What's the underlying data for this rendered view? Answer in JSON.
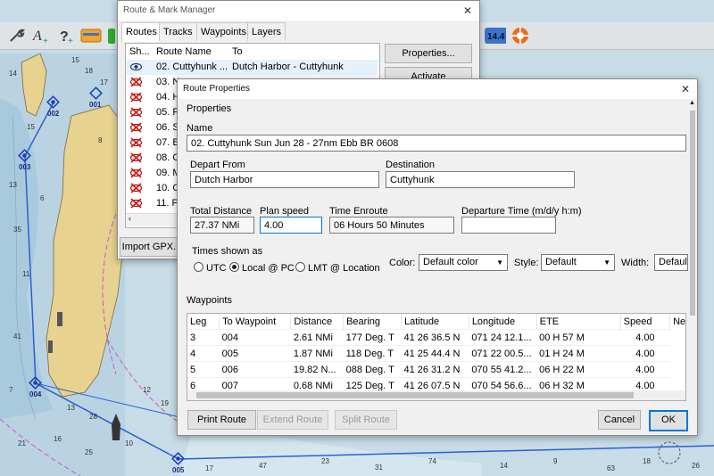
{
  "toolbar": {
    "icons": [
      "wrench-icon",
      "add-route-icon",
      "help-icon",
      "layers-icon",
      "battery-icon",
      "zoom-14-icon",
      "lifebuoy-icon"
    ],
    "zoom_label": "14.4"
  },
  "map": {
    "waypoint_labels": [
      "002",
      "003",
      "004",
      "005",
      "001"
    ],
    "depth_numbers": [
      "15",
      "18",
      "14",
      "17",
      "15",
      "13",
      "35",
      "11",
      "8",
      "6",
      "41",
      "7",
      "13",
      "28",
      "12",
      "19",
      "21",
      "16",
      "25",
      "10",
      "17",
      "47",
      "23",
      "31",
      "74",
      "14",
      "9",
      "63",
      "18",
      "26"
    ]
  },
  "route_manager": {
    "title": "Route & Mark Manager",
    "tabs": [
      "Routes",
      "Tracks",
      "Waypoints",
      "Layers"
    ],
    "columns": [
      "Sh...",
      "Route Name",
      "To"
    ],
    "rows": [
      {
        "name": "02. Cuttyhunk ...",
        "to": "Dutch Harbor - Cuttyhunk",
        "shown": true
      },
      {
        "name": "03. N",
        "to": "",
        "shown": false
      },
      {
        "name": "04. H",
        "to": "",
        "shown": false
      },
      {
        "name": "05. R",
        "to": "",
        "shown": false
      },
      {
        "name": "06. S",
        "to": "",
        "shown": false
      },
      {
        "name": "07. B",
        "to": "",
        "shown": false
      },
      {
        "name": "08. C",
        "to": "",
        "shown": false
      },
      {
        "name": "09. M",
        "to": "",
        "shown": false
      },
      {
        "name": "10. G",
        "to": "",
        "shown": false
      },
      {
        "name": "11. P",
        "to": "",
        "shown": false
      }
    ],
    "properties_button": "Properties...",
    "activate_button": "Activate",
    "import_button": "Import GPX..."
  },
  "route_props": {
    "title": "Route Properties",
    "properties_section": "Properties",
    "name_label": "Name",
    "name_value": "02. Cuttyhunk Sun Jun 28 -  27nm Ebb BR 0608",
    "depart_label": "Depart From",
    "depart_value": "Dutch Harbor",
    "destination_label": "Destination",
    "destination_value": "Cuttyhunk",
    "total_distance_label": "Total Distance",
    "total_distance_value": "27.37 NMi",
    "plan_speed_label": "Plan speed",
    "plan_speed_value": "4.00",
    "time_enroute_label": "Time Enroute",
    "time_enroute_value": "06 Hours  50 Minutes",
    "departure_time_label": "Departure Time (m/d/y h:m)",
    "departure_time_value": "",
    "times_shown_label": "Times shown as",
    "time_options": [
      "UTC",
      "Local @ PC",
      "LMT @ Location"
    ],
    "time_selected": "Local @ PC",
    "color_label": "Color:",
    "color_value": "Default color",
    "style_label": "Style:",
    "style_value": "Default",
    "width_label": "Width:",
    "width_value": "Default",
    "waypoints_section": "Waypoints",
    "wp_columns": [
      "Leg",
      "To Waypoint",
      "Distance",
      "Bearing",
      "Latitude",
      "Longitude",
      "ETE",
      "Speed",
      "Ne"
    ],
    "wp_rows": [
      [
        "3",
        "004",
        "2.61 NMi",
        "177 Deg. T",
        "41 26 36.5 N",
        "071 24 12.1...",
        "00 H  57 M",
        "4.00"
      ],
      [
        "4",
        "005",
        "1.87 NMi",
        "118 Deg. T",
        "41 25 44.4 N",
        "071 22 00.5...",
        "01 H  24 M",
        "4.00"
      ],
      [
        "5",
        "006",
        "19.82 N...",
        "088 Deg. T",
        "41 26 31.2 N",
        "070 55 41.2...",
        "06 H  22 M",
        "4.00"
      ],
      [
        "6",
        "007",
        "0.68 NMi",
        "125 Deg. T",
        "41 26 07.5 N",
        "070 54 56.6...",
        "06 H  32 M",
        "4.00"
      ]
    ],
    "print_button": "Print Route",
    "extend_button": "Extend Route",
    "split_button": "Split Route",
    "cancel_button": "Cancel",
    "ok_button": "OK"
  },
  "colors": {
    "map_water": "#c7dce6",
    "land": "#e8d28f",
    "route_line": "#2b5fd6",
    "accent_ok": "#0078d7",
    "selected_row": "#e5f1fb"
  }
}
